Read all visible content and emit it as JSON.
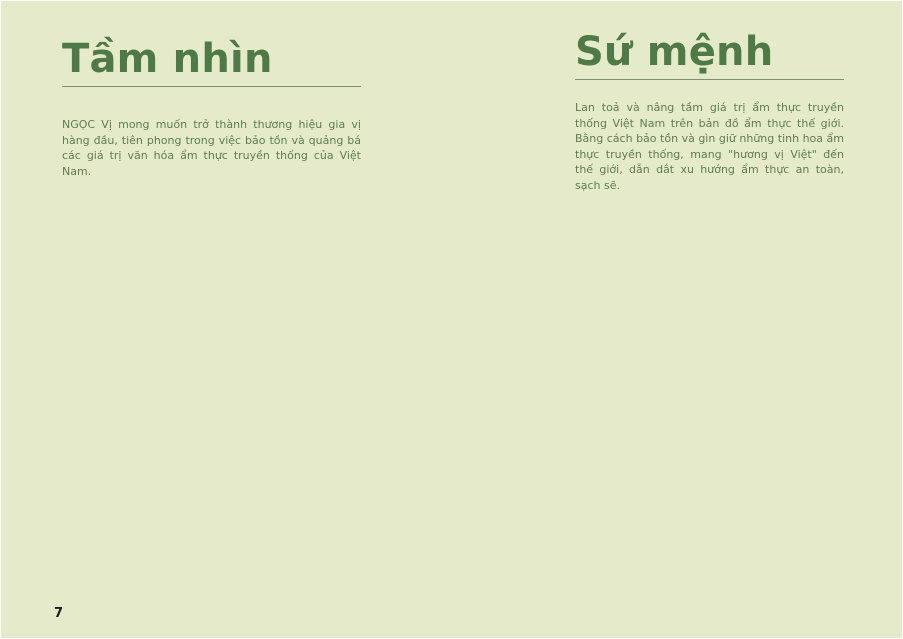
{
  "vision": {
    "heading": "Tầm nhìn",
    "body": "NGỌC Vị mong muốn trở thành thương hiệu gia vị hàng đầu, tiên phong trong việc bảo tồn và quảng bá các giá trị văn hóa ẩm thực truyền thống của Việt Nam."
  },
  "mission": {
    "heading": "Sứ mệnh",
    "body": "Lan toả và nâng tầm giá trị ẩm thực truyền thống Việt Nam trên bản đồ ẩm thực thế giới. Bằng cách bảo tồn và gìn giữ những tinh hoa ẩm thực truyền thống, mang \"hương vị Việt\" đến thế giới, dẫn dắt xu hướng ẩm thực an toàn, sạch sẽ."
  },
  "page_number": "7",
  "colors": {
    "background": "#e5ebca",
    "heading": "#4f7a47",
    "body_text": "#5e7d4f",
    "rule": "#7e8f74"
  }
}
